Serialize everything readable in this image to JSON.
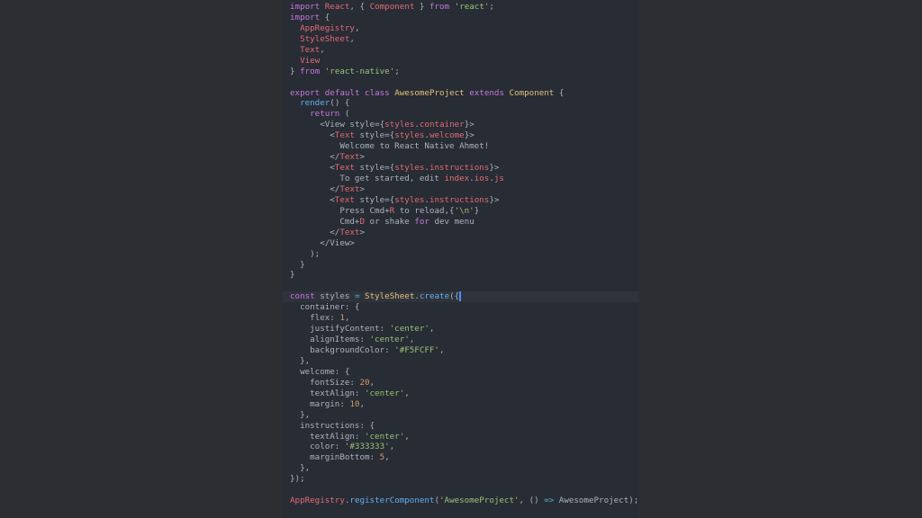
{
  "colors": {
    "background": "#2c2e31",
    "editor_background": "#282c34",
    "keyword": "#c678dd",
    "class": "#e5c07b",
    "tag": "#e06c75",
    "string": "#98c379",
    "number": "#d19a66",
    "function": "#61afef",
    "plain": "#abb2bf",
    "operator": "#56b6c2",
    "cursor": "#528bff"
  },
  "cursor_line": 27,
  "lines": [
    [
      [
        "kw",
        "import"
      ],
      [
        "pl",
        " "
      ],
      [
        "tag",
        "React"
      ],
      [
        "pl",
        ", { "
      ],
      [
        "tag",
        "Component"
      ],
      [
        "pl",
        " } "
      ],
      [
        "kw",
        "from"
      ],
      [
        "pl",
        " "
      ],
      [
        "str",
        "'react'"
      ],
      [
        "pl",
        ";"
      ]
    ],
    [
      [
        "kw",
        "import"
      ],
      [
        "pl",
        " {"
      ]
    ],
    [
      [
        "pl",
        "  "
      ],
      [
        "tag",
        "AppRegistry"
      ],
      [
        "pl",
        ","
      ]
    ],
    [
      [
        "pl",
        "  "
      ],
      [
        "tag",
        "StyleSheet"
      ],
      [
        "pl",
        ","
      ]
    ],
    [
      [
        "pl",
        "  "
      ],
      [
        "tag",
        "Text"
      ],
      [
        "pl",
        ","
      ]
    ],
    [
      [
        "pl",
        "  "
      ],
      [
        "tag",
        "View"
      ]
    ],
    [
      [
        "pl",
        "} "
      ],
      [
        "kw",
        "from"
      ],
      [
        "pl",
        " "
      ],
      [
        "str",
        "'react-native'"
      ],
      [
        "pl",
        ";"
      ]
    ],
    [],
    [
      [
        "kw",
        "export"
      ],
      [
        "pl",
        " "
      ],
      [
        "kw",
        "default"
      ],
      [
        "pl",
        " "
      ],
      [
        "kw",
        "class"
      ],
      [
        "pl",
        " "
      ],
      [
        "cls",
        "AwesomeProject"
      ],
      [
        "pl",
        " "
      ],
      [
        "kw",
        "extends"
      ],
      [
        "pl",
        " "
      ],
      [
        "cls",
        "Component"
      ],
      [
        "pl",
        " {"
      ]
    ],
    [
      [
        "pl",
        "  "
      ],
      [
        "fn",
        "render"
      ],
      [
        "pl",
        "() {"
      ]
    ],
    [
      [
        "pl",
        "    "
      ],
      [
        "kw",
        "return"
      ],
      [
        "pl",
        " ("
      ]
    ],
    [
      [
        "pl",
        "      <"
      ],
      [
        "pl",
        "View"
      ],
      [
        "pl",
        " style={"
      ],
      [
        "tag",
        "styles"
      ],
      [
        "pl",
        "."
      ],
      [
        "tag",
        "container"
      ],
      [
        "pl",
        "}>"
      ]
    ],
    [
      [
        "pl",
        "        <"
      ],
      [
        "tag",
        "Text"
      ],
      [
        "pl",
        " style={"
      ],
      [
        "tag",
        "styles"
      ],
      [
        "pl",
        "."
      ],
      [
        "tag",
        "welcome"
      ],
      [
        "pl",
        "}>"
      ]
    ],
    [
      [
        "pl",
        "          Welcome to React Native Ahmet!"
      ]
    ],
    [
      [
        "pl",
        "        </"
      ],
      [
        "tag",
        "Text"
      ],
      [
        "pl",
        ">"
      ]
    ],
    [
      [
        "pl",
        "        <"
      ],
      [
        "tag",
        "Text"
      ],
      [
        "pl",
        " style={"
      ],
      [
        "tag",
        "styles"
      ],
      [
        "pl",
        "."
      ],
      [
        "tag",
        "instructions"
      ],
      [
        "pl",
        "}>"
      ]
    ],
    [
      [
        "pl",
        "          To get started, edit "
      ],
      [
        "tag",
        "index"
      ],
      [
        "pl",
        "."
      ],
      [
        "tag",
        "ios"
      ],
      [
        "pl",
        "."
      ],
      [
        "tag",
        "js"
      ]
    ],
    [
      [
        "pl",
        "        </"
      ],
      [
        "tag",
        "Text"
      ],
      [
        "pl",
        ">"
      ]
    ],
    [
      [
        "pl",
        "        <"
      ],
      [
        "tag",
        "Text"
      ],
      [
        "pl",
        " style={"
      ],
      [
        "tag",
        "styles"
      ],
      [
        "pl",
        "."
      ],
      [
        "tag",
        "instructions"
      ],
      [
        "pl",
        "}>"
      ]
    ],
    [
      [
        "pl",
        "          Press Cmd+"
      ],
      [
        "tag",
        "R"
      ],
      [
        "pl",
        " to reload,{"
      ],
      [
        "str",
        "'\\n'"
      ],
      [
        "pl",
        "}"
      ]
    ],
    [
      [
        "pl",
        "          Cmd+"
      ],
      [
        "tag",
        "D"
      ],
      [
        "pl",
        " or shake "
      ],
      [
        "kw",
        "for"
      ],
      [
        "pl",
        " dev menu"
      ]
    ],
    [
      [
        "pl",
        "        </"
      ],
      [
        "tag",
        "Text"
      ],
      [
        "pl",
        ">"
      ]
    ],
    [
      [
        "pl",
        "      </"
      ],
      [
        "pl",
        "View"
      ],
      [
        "pl",
        ">"
      ]
    ],
    [
      [
        "pl",
        "    );"
      ]
    ],
    [
      [
        "pl",
        "  }"
      ]
    ],
    [
      [
        "pl",
        "}"
      ]
    ],
    [],
    [
      [
        "kw",
        "const"
      ],
      [
        "pl",
        " styles "
      ],
      [
        "op",
        "="
      ],
      [
        "pl",
        " "
      ],
      [
        "cls",
        "StyleSheet"
      ],
      [
        "pl",
        "."
      ],
      [
        "fn",
        "create"
      ],
      [
        "pl",
        "({"
      ]
    ],
    [
      [
        "pl",
        "  container: {"
      ]
    ],
    [
      [
        "pl",
        "    flex: "
      ],
      [
        "num",
        "1"
      ],
      [
        "pl",
        ","
      ]
    ],
    [
      [
        "pl",
        "    justifyContent: "
      ],
      [
        "str",
        "'center'"
      ],
      [
        "pl",
        ","
      ]
    ],
    [
      [
        "pl",
        "    alignItems: "
      ],
      [
        "str",
        "'center'"
      ],
      [
        "pl",
        ","
      ]
    ],
    [
      [
        "pl",
        "    backgroundColor: "
      ],
      [
        "str",
        "'#F5FCFF'"
      ],
      [
        "pl",
        ","
      ]
    ],
    [
      [
        "pl",
        "  },"
      ]
    ],
    [
      [
        "pl",
        "  welcome: {"
      ]
    ],
    [
      [
        "pl",
        "    fontSize: "
      ],
      [
        "num",
        "20"
      ],
      [
        "pl",
        ","
      ]
    ],
    [
      [
        "pl",
        "    textAlign: "
      ],
      [
        "str",
        "'center'"
      ],
      [
        "pl",
        ","
      ]
    ],
    [
      [
        "pl",
        "    margin: "
      ],
      [
        "num",
        "10"
      ],
      [
        "pl",
        ","
      ]
    ],
    [
      [
        "pl",
        "  },"
      ]
    ],
    [
      [
        "pl",
        "  instructions: {"
      ]
    ],
    [
      [
        "pl",
        "    textAlign: "
      ],
      [
        "str",
        "'center'"
      ],
      [
        "pl",
        ","
      ]
    ],
    [
      [
        "pl",
        "    color: "
      ],
      [
        "str",
        "'#333333'"
      ],
      [
        "pl",
        ","
      ]
    ],
    [
      [
        "pl",
        "    marginBottom: "
      ],
      [
        "num",
        "5"
      ],
      [
        "pl",
        ","
      ]
    ],
    [
      [
        "pl",
        "  },"
      ]
    ],
    [
      [
        "pl",
        "});"
      ]
    ],
    [],
    [
      [
        "tag",
        "AppRegistry"
      ],
      [
        "pl",
        "."
      ],
      [
        "fn",
        "registerComponent"
      ],
      [
        "pl",
        "("
      ],
      [
        "str",
        "'AwesomeProject'"
      ],
      [
        "pl",
        ", () "
      ],
      [
        "op",
        "=>"
      ],
      [
        "pl",
        " AwesomeProject);"
      ]
    ]
  ]
}
